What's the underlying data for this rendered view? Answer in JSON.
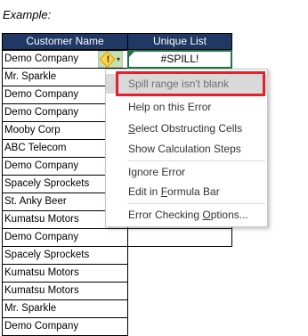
{
  "example_label": "Example:",
  "headers": {
    "customer_name": "Customer Name",
    "unique_list": "Unique List"
  },
  "spill_value": "#SPILL!",
  "customers": [
    "Demo Company",
    "Mr. Sparkle",
    "Demo Company",
    "Demo Company",
    "Mooby Corp",
    "ABC Telecom",
    "Demo Company",
    "Spacely Sprockets",
    "St. Anky Beer",
    "Kumatsu Motors",
    "Demo Company",
    "Spacely Sprockets",
    "Kumatsu Motors",
    "Kumatsu Motors",
    "Mr. Sparkle",
    "Demo Company"
  ],
  "error_button": {
    "icon": "warning-icon",
    "glyph": "!",
    "dropdown": "▾"
  },
  "menu": {
    "title": "Spill range isn't blank",
    "help": "Help on this Error",
    "select_obstructing": "Select Obstructing Cells",
    "show_steps": "Show Calculation Steps",
    "ignore": "Ignore Error",
    "edit_formula_bar": "Edit in Formula Bar",
    "options": "Error Checking Options..."
  },
  "colors": {
    "header_bg": "#1f3864",
    "highlight_box": "#e4202a",
    "spill_border": "#217346"
  }
}
